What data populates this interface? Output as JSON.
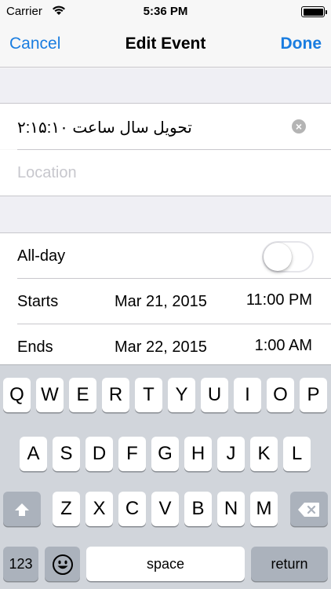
{
  "status_bar": {
    "carrier": "Carrier",
    "time": "5:36 PM"
  },
  "nav": {
    "cancel_label": "Cancel",
    "title": "Edit Event",
    "done_label": "Done"
  },
  "event": {
    "title_value": "تحویل سال ساعت ۲:۱۵:۱۰",
    "location_placeholder": "Location",
    "allday_label": "All-day",
    "allday_on": false,
    "starts_label": "Starts",
    "starts_date": "Mar 21, 2015",
    "starts_time": "11:00 PM",
    "ends_label": "Ends",
    "ends_date": "Mar 22, 2015",
    "ends_time": "1:00 AM"
  },
  "keyboard": {
    "row1": [
      "Q",
      "W",
      "E",
      "R",
      "T",
      "Y",
      "U",
      "I",
      "O",
      "P"
    ],
    "row2": [
      "A",
      "S",
      "D",
      "F",
      "G",
      "H",
      "J",
      "K",
      "L"
    ],
    "row3": [
      "Z",
      "X",
      "C",
      "V",
      "B",
      "N",
      "M"
    ],
    "numbers_label": "123",
    "space_label": "space",
    "return_label": "return",
    "shift_icon": "shift-icon",
    "delete_icon": "delete-icon",
    "emoji_icon": "emoji-icon"
  },
  "colors": {
    "accent": "#1a7de0",
    "keyboard_bg": "#d1d5db",
    "group_bg": "#efeff4"
  }
}
